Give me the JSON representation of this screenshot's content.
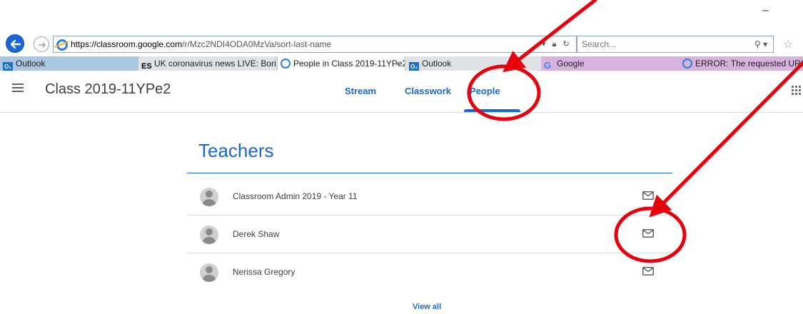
{
  "browser": {
    "address_url": "https://classroom.google.com/r/Mzc2NDI4ODA0MzVa/sort-last-name",
    "address_host": "https://classroom.google.com",
    "address_path": "/r/Mzc2NDI4ODA0MzVa/sort-last-name",
    "search_placeholder": "Search...",
    "minimize_glyph": "–",
    "tabs": [
      {
        "label": "Outlook",
        "icon": "outlook-icon",
        "icon_text": "O₂",
        "color": "#a9c6e3"
      },
      {
        "label": "UK coronavirus news LIVE: Bori...",
        "icon": "es-icon",
        "icon_text": "ES",
        "color": "#dfe3e8"
      },
      {
        "label": "People in Class 2019-11YPe2",
        "icon": "ie-icon",
        "active": true,
        "close": "×"
      },
      {
        "label": "Outlook",
        "icon": "outlook-icon",
        "icon_text": "O₂",
        "color": "#dfe3e8"
      },
      {
        "label": "Google",
        "icon": "google-icon",
        "icon_text": "G",
        "color": "#d8b3de"
      },
      {
        "label": "ERROR: The requested URL cou",
        "icon": "ie-icon",
        "color": "#d8b3de"
      }
    ]
  },
  "classroom": {
    "class_title": "Class 2019-11YPe2",
    "nav_tabs": {
      "stream": "Stream",
      "classwork": "Classwork",
      "people": "People"
    },
    "active_tab": "People",
    "accent_color": "#1967d2"
  },
  "teachers": {
    "heading": "Teachers",
    "rows": [
      {
        "name": "Classroom Admin 2019 - Year 11"
      },
      {
        "name": "Derek Shaw"
      },
      {
        "name": "Nerissa Gregory"
      }
    ],
    "view_all": "View all"
  },
  "annotations": {
    "color": "#e8000d",
    "highlights": [
      "people-tab",
      "email-button-derek-shaw"
    ]
  }
}
